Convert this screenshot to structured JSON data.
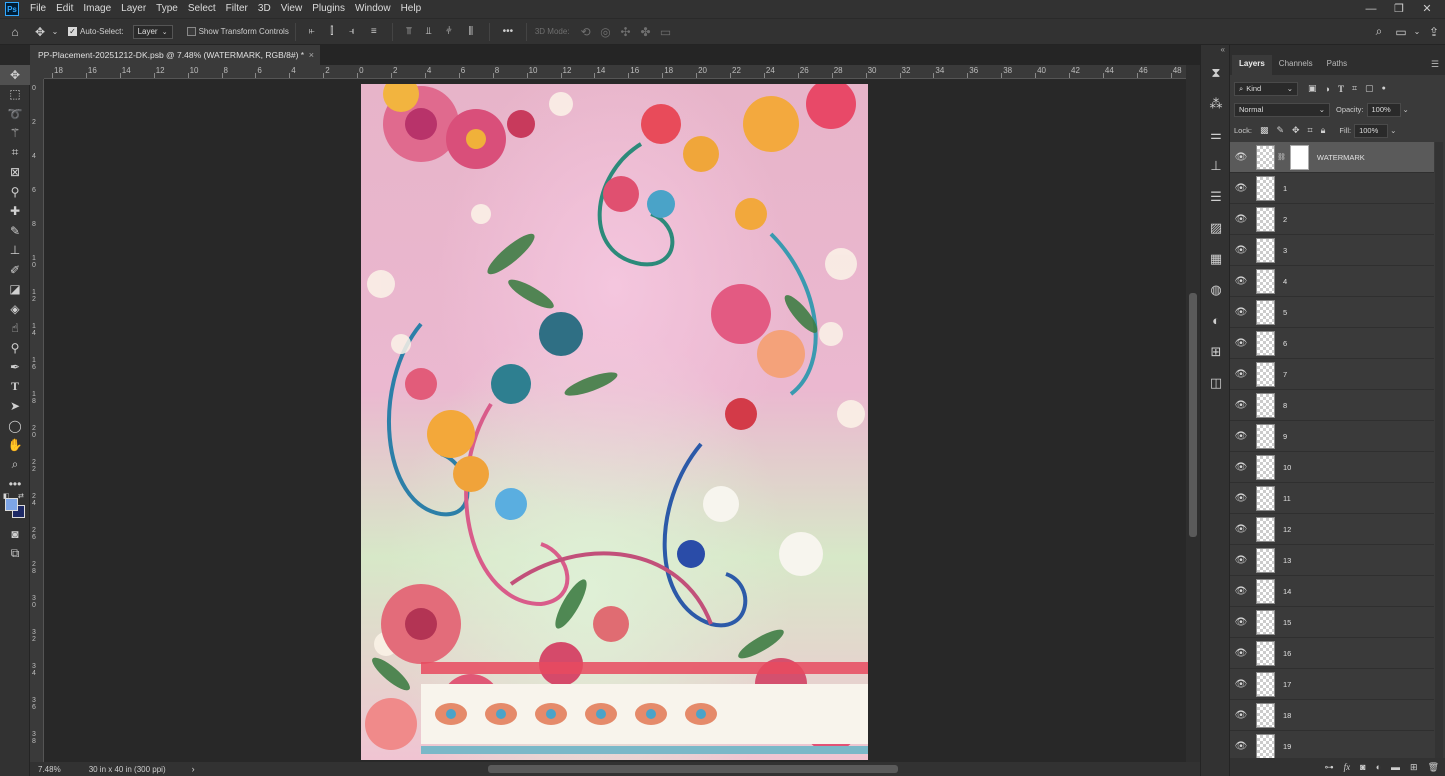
{
  "menu": {
    "logo": "Ps",
    "items": [
      "File",
      "Edit",
      "Image",
      "Layer",
      "Type",
      "Select",
      "Filter",
      "3D",
      "View",
      "Plugins",
      "Window",
      "Help"
    ],
    "window_controls": [
      "—",
      "❐",
      "✕"
    ]
  },
  "options": {
    "auto_select_label": "Auto-Select:",
    "auto_select_target": "Layer",
    "transform_controls_label": "Show Transform Controls",
    "more_label": "•••",
    "mode_3d_label": "3D Mode:"
  },
  "document": {
    "tab_title": "PP-Placement-20251212-DK.psb @ 7.48% (WATERMARK, RGB/8#) *",
    "close": "×"
  },
  "ruler": {
    "h_labels": [
      "18",
      "16",
      "14",
      "12",
      "10",
      "8",
      "6",
      "4",
      "2",
      "0",
      "2",
      "4",
      "6",
      "8",
      "10",
      "12",
      "14",
      "16",
      "18",
      "20",
      "22",
      "24",
      "26",
      "28",
      "30",
      "32",
      "34",
      "36",
      "38",
      "40",
      "42",
      "44",
      "46",
      "48"
    ],
    "v_labels": [
      "0",
      "2",
      "4",
      "6",
      "8",
      "1\n0",
      "1\n2",
      "1\n4",
      "1\n6",
      "1\n8",
      "2\n0",
      "2\n2",
      "2\n4",
      "2\n6",
      "2\n8",
      "3\n0",
      "3\n2",
      "3\n4",
      "3\n6",
      "3\n8"
    ]
  },
  "status": {
    "zoom": "7.48%",
    "doc_size": "30 in x 40 in (300 ppi)",
    "arrow": "›"
  },
  "panel": {
    "tabs": [
      "Layers",
      "Channels",
      "Paths"
    ],
    "filter_kind": "Kind",
    "blend_mode": "Normal",
    "opacity_label": "Opacity:",
    "opacity_value": "100%",
    "lock_label": "Lock:",
    "fill_label": "Fill:",
    "fill_value": "100%",
    "layers": [
      "WATERMARK",
      "1",
      "2",
      "3",
      "4",
      "5",
      "6",
      "7",
      "8",
      "9",
      "10",
      "11",
      "12",
      "13",
      "14",
      "15",
      "16",
      "17",
      "18",
      "19"
    ],
    "selected_layer": "WATERMARK"
  },
  "colors": {
    "foreground": "#7da5e6",
    "background": "#1e2a66",
    "accent": "#31a8ff"
  }
}
